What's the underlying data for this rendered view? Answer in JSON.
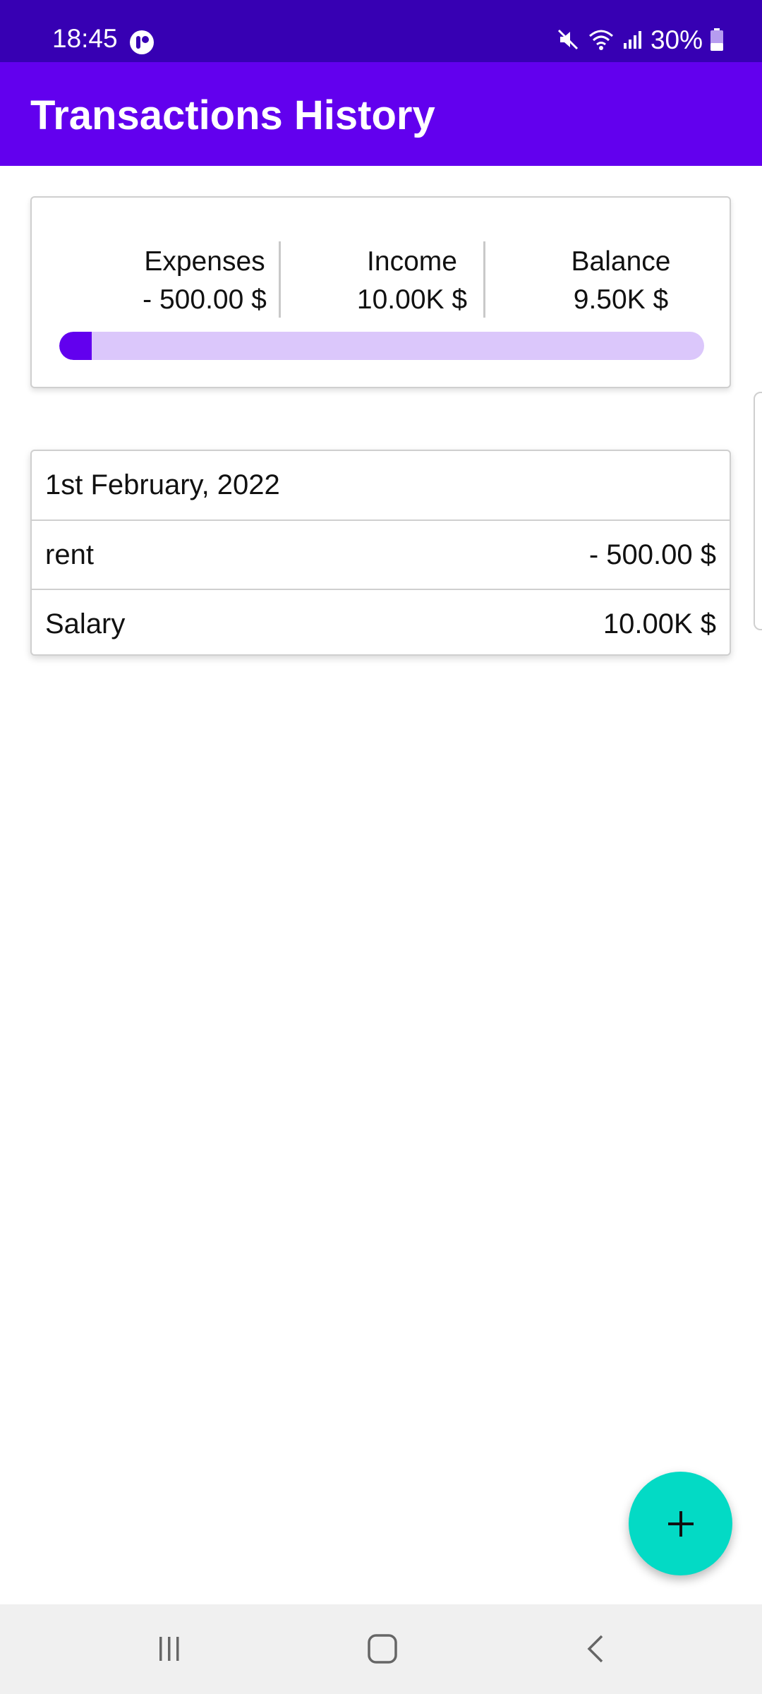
{
  "status_bar": {
    "time": "18:45",
    "battery": "30%",
    "icons": [
      "app-notification-icon",
      "mute-icon",
      "wifi-icon",
      "signal-icon",
      "battery-icon"
    ]
  },
  "app_bar": {
    "title": "Transactions History"
  },
  "summary": {
    "expenses": {
      "label": "Expenses",
      "value": "- 500.00 $"
    },
    "income": {
      "label": "Income",
      "value": "10.00K $"
    },
    "balance": {
      "label": "Balance",
      "value": "9.50K $"
    },
    "expense_ratio": 0.05
  },
  "transactions": {
    "date": "1st February, 2022",
    "items": [
      {
        "name": "rent",
        "amount": "- 500.00 $"
      },
      {
        "name": "Salary",
        "amount": "10.00K $"
      }
    ]
  },
  "fab": {
    "icon": "plus-icon"
  },
  "nav_bar": {
    "icons": [
      "recents-icon",
      "home-icon",
      "back-icon"
    ]
  },
  "colors": {
    "status_bar": "#3700b3",
    "app_bar": "#6200ee",
    "progress_fill": "#6200ee",
    "progress_track": "#dbc7fb",
    "fab": "#03dac5"
  }
}
